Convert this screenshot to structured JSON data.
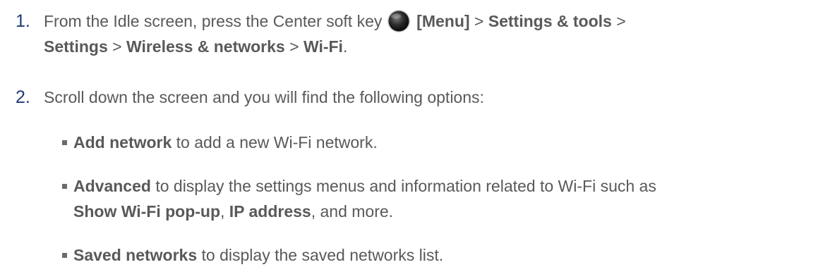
{
  "steps": [
    {
      "number": "1.",
      "prefix": "From the Idle screen, press the Center soft key ",
      "key_icon": "center-soft-key-icon",
      "menu": "[Menu]",
      "gt1": " > ",
      "settings_tools": "Settings & tools",
      "gt2": " >",
      "settings": "Settings",
      "gt3": " > ",
      "wireless": "Wireless & networks",
      "gt4": " > ",
      "wifi": "Wi-Fi",
      "end": "."
    },
    {
      "number": "2.",
      "text": "Scroll down the screen and you will find the following options:"
    }
  ],
  "options": [
    {
      "term": "Add network",
      "desc": " to add a new Wi-Fi network."
    },
    {
      "term": "Advanced",
      "desc": " to display the settings menus and information related to Wi-Fi such as",
      "term2": "Show Wi-Fi pop-up",
      "sep": ", ",
      "term3": "IP address",
      "tail": ", and more."
    },
    {
      "term": "Saved networks",
      "desc": " to display the saved networks list."
    }
  ]
}
